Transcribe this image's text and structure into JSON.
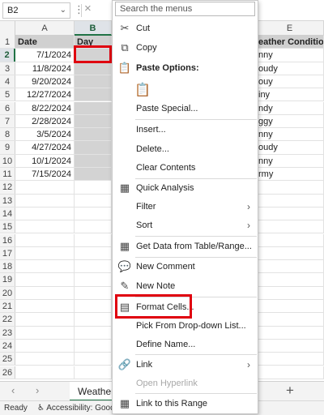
{
  "formula_bar": {
    "name_box": "B2",
    "cancel_icon": "×",
    "dots": "⋮"
  },
  "columns": [
    {
      "letter": "A",
      "selected": false
    },
    {
      "letter": "B",
      "selected": true
    },
    {
      "letter": "E",
      "selected": false
    }
  ],
  "rows": [
    {
      "num": "1",
      "a": "Date",
      "b": "Day",
      "e": "eather Condition",
      "header": true
    },
    {
      "num": "2",
      "a": "7/1/2024",
      "b": "",
      "e": "nny"
    },
    {
      "num": "3",
      "a": "11/8/2024",
      "b": "",
      "e": "oudy"
    },
    {
      "num": "4",
      "a": "9/20/2024",
      "b": "",
      "e": "ouy"
    },
    {
      "num": "5",
      "a": "12/27/2024",
      "b": "",
      "e": "iny"
    },
    {
      "num": "6",
      "a": "8/22/2024",
      "b": "",
      "e": "ndy"
    },
    {
      "num": "7",
      "a": "2/28/2024",
      "b": "",
      "e": "ggy"
    },
    {
      "num": "8",
      "a": "3/5/2024",
      "b": "",
      "e": "nny"
    },
    {
      "num": "9",
      "a": "4/27/2024",
      "b": "",
      "e": "oudy"
    },
    {
      "num": "10",
      "a": "10/1/2024",
      "b": "",
      "e": "nny"
    },
    {
      "num": "11",
      "a": "7/15/2024",
      "b": "",
      "e": "rmy"
    },
    {
      "num": "12"
    },
    {
      "num": "13"
    },
    {
      "num": "14"
    },
    {
      "num": "15"
    },
    {
      "num": "16"
    },
    {
      "num": "17"
    },
    {
      "num": "18"
    },
    {
      "num": "19"
    },
    {
      "num": "20"
    },
    {
      "num": "21"
    },
    {
      "num": "22"
    },
    {
      "num": "23"
    },
    {
      "num": "24"
    },
    {
      "num": "25"
    },
    {
      "num": "26"
    }
  ],
  "sheet_tabs": {
    "active": "Weather",
    "add": "+"
  },
  "status_bar": {
    "ready": "Ready",
    "accessibility": "Accessibility: Good to go"
  },
  "context_menu": {
    "search_placeholder": "Search the menus",
    "items": [
      {
        "label": "Cut",
        "icon": "✂"
      },
      {
        "label": "Copy",
        "icon": "⧉"
      },
      {
        "label": "Paste Options:",
        "icon": "📋"
      },
      {
        "label": "",
        "icon": "📋"
      },
      {
        "label": "Paste Special..."
      },
      {
        "label": "Insert..."
      },
      {
        "label": "Delete..."
      },
      {
        "label": "Clear Contents"
      },
      {
        "label": "Quick Analysis",
        "icon": "▦"
      },
      {
        "label": "Filter"
      },
      {
        "label": "Sort"
      },
      {
        "label": "Get Data from Table/Range...",
        "icon": "▦"
      },
      {
        "label": "New Comment",
        "icon": "💬"
      },
      {
        "label": "New Note",
        "icon": "✎"
      },
      {
        "label": "Format Cells...",
        "icon": "▤"
      },
      {
        "label": "Pick From Drop-down List..."
      },
      {
        "label": "Define Name..."
      },
      {
        "label": "Link",
        "icon": "🔗"
      },
      {
        "label": "Open Hyperlink"
      },
      {
        "label": "Link to this Range",
        "icon": "▦"
      }
    ]
  },
  "colors": {
    "highlight": "#e0000f",
    "accent": "#217346",
    "selected_fill": "#d3d3d3"
  }
}
